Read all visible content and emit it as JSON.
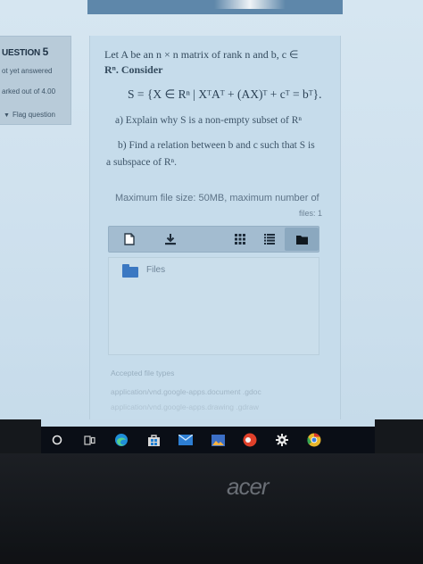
{
  "sidebar": {
    "question_label": "UESTION",
    "question_number": "5",
    "status": "ot yet answered",
    "marks": "arked out of 4.00",
    "flag_label": "Flag question"
  },
  "question": {
    "intro_line1": "Let A be an n × n matrix of rank n and b, c ∈",
    "intro_line2": "Rⁿ. Consider",
    "formula": "S = {X ∈ Rⁿ | XᵀAᵀ + (AX)ᵀ + cᵀ = bᵀ}.",
    "part_a": "a) Explain why S is a non-empty subset of Rⁿ",
    "part_b_line1": "b) Find a relation between b and c such that S is",
    "part_b_line2": "a subspace of Rⁿ."
  },
  "filepicker": {
    "max_size": "Maximum file size: 50MB, maximum number of",
    "max_files": "files: 1",
    "tools": [
      {
        "name": "add-file-icon"
      },
      {
        "name": "download-icon"
      },
      {
        "name": "grid-view-icon"
      },
      {
        "name": "list-view-icon"
      },
      {
        "name": "folder-view-icon"
      }
    ],
    "folder_label": "Files",
    "accepted_title": "Accepted file types",
    "mime_1": "application/vnd.google-apps.document .gdoc",
    "mime_2": "application/vnd.google-apps.drawing .gdraw"
  },
  "taskbar": {
    "apps": [
      "search-circle-icon",
      "task-view-icon",
      "edge-icon",
      "store-icon",
      "mail-icon",
      "photos-icon",
      "office-icon",
      "settings-icon",
      "chrome-icon"
    ]
  },
  "device": {
    "brand": "acer"
  },
  "colors": {
    "accent": "#5e87aa",
    "card": "#c6dceb",
    "taskbar": "#0a0e16"
  }
}
